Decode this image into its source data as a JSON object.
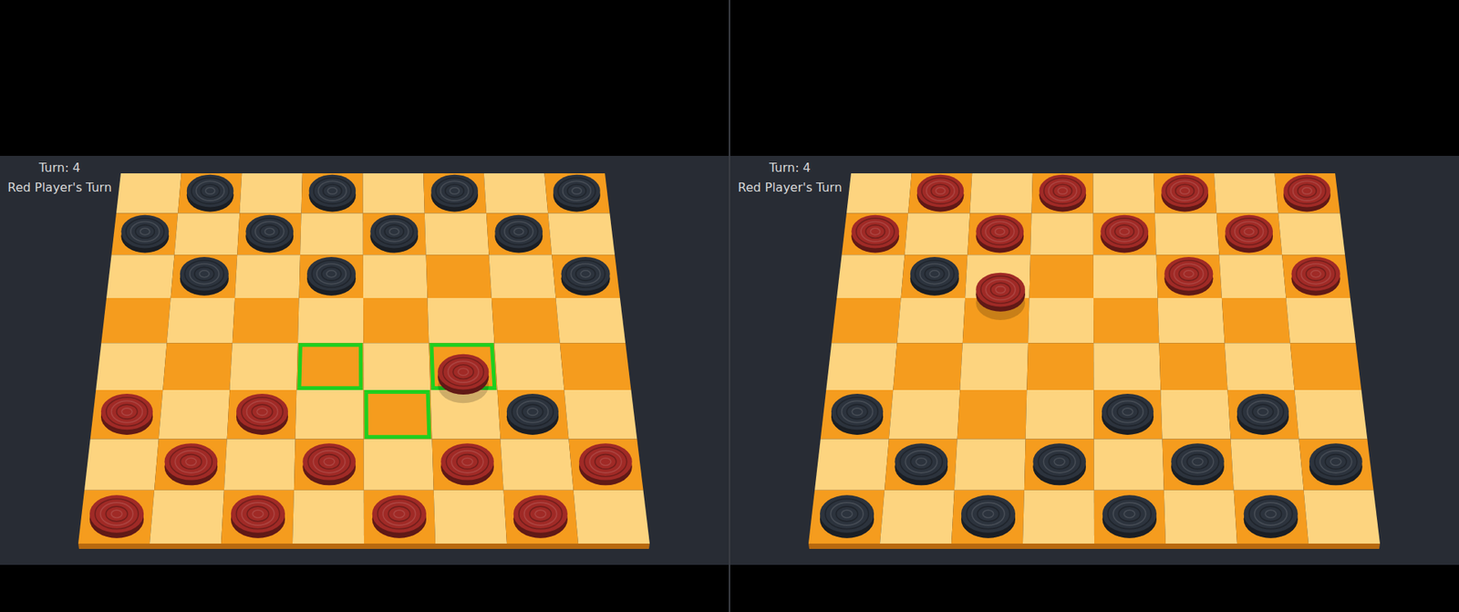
{
  "panels": [
    {
      "turn_label": "Turn: 4",
      "status": "Red Player's Turn",
      "highlights": [
        {
          "row": 4,
          "col": 3
        },
        {
          "row": 4,
          "col": 5
        },
        {
          "row": 5,
          "col": 4
        }
      ],
      "pieces": [
        {
          "row": 0,
          "col": 1,
          "color": "#2c333d",
          "dragging": false
        },
        {
          "row": 0,
          "col": 3,
          "color": "#2c333d",
          "dragging": false
        },
        {
          "row": 0,
          "col": 5,
          "color": "#2c333d",
          "dragging": false
        },
        {
          "row": 0,
          "col": 7,
          "color": "#2c333d",
          "dragging": false
        },
        {
          "row": 1,
          "col": 0,
          "color": "#2c333d",
          "dragging": false
        },
        {
          "row": 1,
          "col": 2,
          "color": "#2c333d",
          "dragging": false
        },
        {
          "row": 1,
          "col": 4,
          "color": "#2c333d",
          "dragging": false
        },
        {
          "row": 1,
          "col": 6,
          "color": "#2c333d",
          "dragging": false
        },
        {
          "row": 2,
          "col": 1,
          "color": "#2c333d",
          "dragging": false
        },
        {
          "row": 2,
          "col": 3,
          "color": "#2c333d",
          "dragging": false
        },
        {
          "row": 2,
          "col": 7,
          "color": "#2c333d",
          "dragging": false
        },
        {
          "row": 4.25,
          "col": 5,
          "color": "#a02a26",
          "dragging": true
        },
        {
          "row": 5,
          "col": 0,
          "color": "#a02a26",
          "dragging": false
        },
        {
          "row": 5,
          "col": 2,
          "color": "#a02a26",
          "dragging": false
        },
        {
          "row": 5,
          "col": 6,
          "color": "#2c333d",
          "dragging": false
        },
        {
          "row": 6,
          "col": 1,
          "color": "#a02a26",
          "dragging": false
        },
        {
          "row": 6,
          "col": 3,
          "color": "#a02a26",
          "dragging": false
        },
        {
          "row": 6,
          "col": 5,
          "color": "#a02a26",
          "dragging": false
        },
        {
          "row": 6,
          "col": 7,
          "color": "#a02a26",
          "dragging": false
        },
        {
          "row": 7,
          "col": 0,
          "color": "#a02a26",
          "dragging": false
        },
        {
          "row": 7,
          "col": 2,
          "color": "#a02a26",
          "dragging": false
        },
        {
          "row": 7,
          "col": 4,
          "color": "#a02a26",
          "dragging": false
        },
        {
          "row": 7,
          "col": 6,
          "color": "#a02a26",
          "dragging": false
        }
      ]
    },
    {
      "turn_label": "Turn: 4",
      "status": "Red Player's Turn",
      "highlights": [],
      "pieces": [
        {
          "row": 0,
          "col": 1,
          "color": "#a02a26",
          "dragging": false
        },
        {
          "row": 0,
          "col": 3,
          "color": "#a02a26",
          "dragging": false
        },
        {
          "row": 0,
          "col": 5,
          "color": "#a02a26",
          "dragging": false
        },
        {
          "row": 0,
          "col": 7,
          "color": "#a02a26",
          "dragging": false
        },
        {
          "row": 1,
          "col": 0,
          "color": "#a02a26",
          "dragging": false
        },
        {
          "row": 1,
          "col": 2,
          "color": "#a02a26",
          "dragging": false
        },
        {
          "row": 1,
          "col": 4,
          "color": "#a02a26",
          "dragging": false
        },
        {
          "row": 1,
          "col": 6,
          "color": "#a02a26",
          "dragging": false
        },
        {
          "row": 2,
          "col": 1,
          "color": "#2c333d",
          "dragging": false
        },
        {
          "row": 2.45,
          "col": 2.05,
          "color": "#a02a26",
          "dragging": true
        },
        {
          "row": 2,
          "col": 5,
          "color": "#a02a26",
          "dragging": false
        },
        {
          "row": 2,
          "col": 7,
          "color": "#a02a26",
          "dragging": false
        },
        {
          "row": 5,
          "col": 0,
          "color": "#2c333d",
          "dragging": false
        },
        {
          "row": 5,
          "col": 4,
          "color": "#2c333d",
          "dragging": false
        },
        {
          "row": 5,
          "col": 6,
          "color": "#2c333d",
          "dragging": false
        },
        {
          "row": 6,
          "col": 1,
          "color": "#2c333d",
          "dragging": false
        },
        {
          "row": 6,
          "col": 3,
          "color": "#2c333d",
          "dragging": false
        },
        {
          "row": 6,
          "col": 5,
          "color": "#2c333d",
          "dragging": false
        },
        {
          "row": 6,
          "col": 7,
          "color": "#2c333d",
          "dragging": false
        },
        {
          "row": 7,
          "col": 0,
          "color": "#2c333d",
          "dragging": false
        },
        {
          "row": 7,
          "col": 2,
          "color": "#2c333d",
          "dragging": false
        },
        {
          "row": 7,
          "col": 4,
          "color": "#2c333d",
          "dragging": false
        },
        {
          "row": 7,
          "col": 6,
          "color": "#2c333d",
          "dragging": false
        }
      ]
    }
  ]
}
